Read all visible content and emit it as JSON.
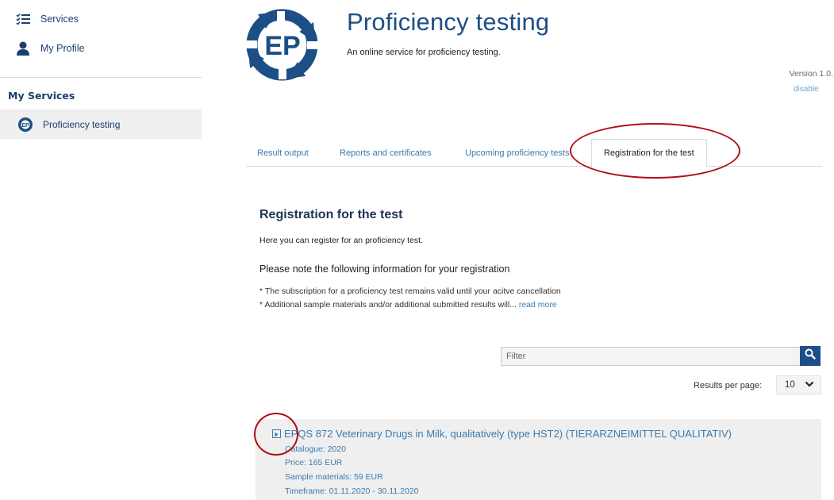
{
  "sidebar": {
    "services_label": "Services",
    "profile_label": "My Profile",
    "heading": "My Services",
    "active_item": "Proficiency testing"
  },
  "header": {
    "logo_text": "EP",
    "title": "Proficiency testing",
    "subtitle": "An online service for proficiency testing.",
    "version": "Version 1.0.",
    "disable_label": "disable"
  },
  "tabs": [
    {
      "label": "Result output"
    },
    {
      "label": "Reports and certificates"
    },
    {
      "label": "Upcoming proficiency tests"
    },
    {
      "label": "Registration for the test"
    }
  ],
  "main": {
    "section_title": "Registration for the test",
    "intro": "Here you can register for an proficiency test.",
    "notice_title": "Please note the following information for your registration",
    "note1": "* The subscription for a proficiency test remains valid until your acitve cancellation",
    "note2": "* Additional sample materials and/or additional submitted results will...",
    "read_more": "read more"
  },
  "filter": {
    "placeholder": "Filter"
  },
  "pagination": {
    "results_per_page_label": "Results per page:",
    "results_per_page_value": "10"
  },
  "results": [
    {
      "title": "EPQS 872 Veterinary Drugs in Milk, qualitatively (type HST2) (TIERARZNEIMITTEL QUALITATIV)",
      "catalogue": "Catalogue: 2020",
      "price": "Price: 165 EUR",
      "samples": "Sample materials: 59 EUR",
      "timeframe": "Timeframe: 01.11.2020 - 30.11.2020"
    }
  ],
  "colors": {
    "brand_blue": "#1c4f85",
    "link_blue": "#3b7bb0",
    "annotation_red": "#b00d14"
  },
  "icons": [
    "checklist-icon",
    "user-icon",
    "ep-logo-icon",
    "search-icon",
    "chevron-down-icon",
    "expand-icon"
  ]
}
